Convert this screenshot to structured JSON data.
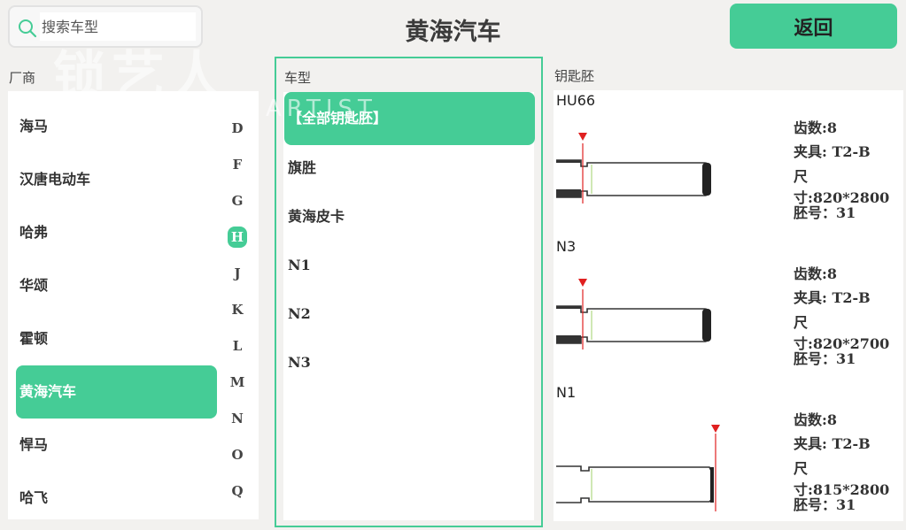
{
  "header": {
    "search_placeholder": "搜索车型",
    "title": "黄海汽车",
    "back_label": "返回",
    "watermark": "锁艺人",
    "watermark_sub": "ARTIST"
  },
  "labels": {
    "maker": "厂商",
    "model": "车型",
    "key_blank": "钥匙胚"
  },
  "makers": [
    "海马",
    "汉唐电动车",
    "哈弗",
    "华颂",
    "霍顿",
    "黄海汽车",
    "悍马",
    "哈飞"
  ],
  "selected_maker": "黄海汽车",
  "letters": [
    "D",
    "F",
    "G",
    "H",
    "J",
    "K",
    "L",
    "M",
    "N",
    "O",
    "Q"
  ],
  "active_letter": "H",
  "models": [
    "【全部钥匙胚】",
    "旗胜",
    "黄海皮卡",
    "N1",
    "N2",
    "N3"
  ],
  "selected_model": "【全部钥匙胚】",
  "blanks": [
    {
      "name": "HU66",
      "teeth": "齿数:8",
      "clamp": "夹具: T2-B",
      "size": "尺寸:820*2800",
      "blank_no": "胚号：31",
      "variant": "a"
    },
    {
      "name": "N3",
      "teeth": "齿数:8",
      "clamp": "夹具: T2-B",
      "size": "尺寸:820*2700",
      "blank_no": "胚号：31",
      "variant": "a"
    },
    {
      "name": "N1",
      "teeth": "齿数:8",
      "clamp": "夹具: T2-B",
      "size": "尺寸:815*2800",
      "blank_no": "胚号：31",
      "variant": "b"
    }
  ],
  "colors": {
    "accent": "#45cc96",
    "marker": "#e02020"
  }
}
